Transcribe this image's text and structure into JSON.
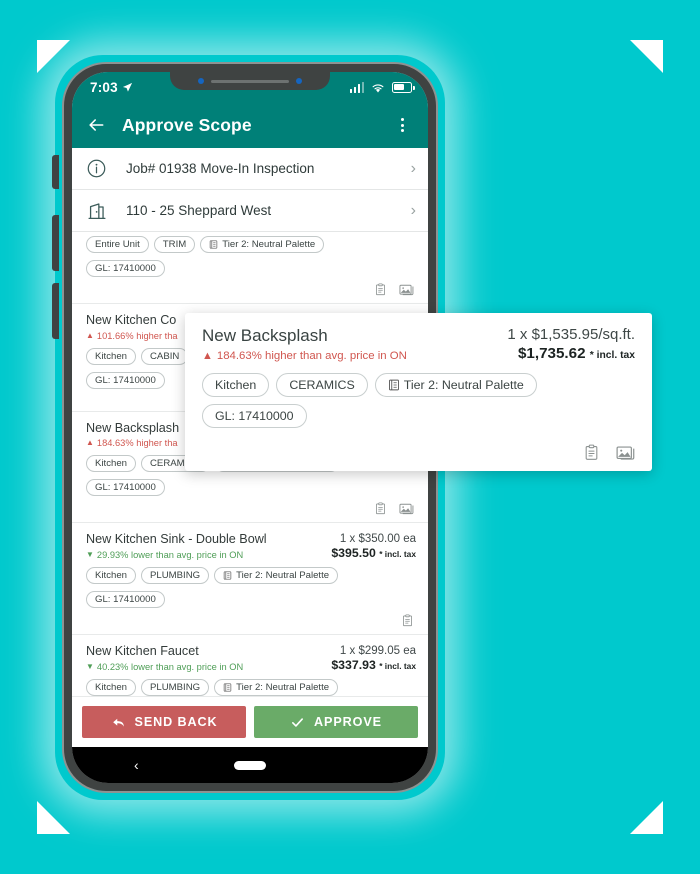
{
  "theme": {
    "background": "#00c9cd",
    "appbar": "#008078",
    "up_color": "#d0564f",
    "down_color": "#4f9e57",
    "send_back_color": "#c75d5d",
    "approve_color": "#6aab68"
  },
  "statusbar": {
    "time": "7:03"
  },
  "appbar": {
    "title": "Approve Scope"
  },
  "header_rows": [
    {
      "icon": "info-circle-icon",
      "text": "Job# 01938 Move-In Inspection"
    },
    {
      "icon": "building-icon",
      "text": "110 - 25 Sheppard West"
    }
  ],
  "items": [
    {
      "name": "",
      "delta": "",
      "delta_dir": "",
      "unit": "",
      "total": "",
      "tax_note": "",
      "chips": [
        "Entire Unit",
        "TRIM",
        "Tier 2: Neutral Palette",
        "GL: 17410000"
      ],
      "palette_chip_index": 2,
      "actions": [
        "clipboard-icon",
        "photo-icon"
      ]
    },
    {
      "name": "New Kitchen Co",
      "delta": "101.66% higher tha",
      "delta_dir": "up",
      "unit": "",
      "total": "",
      "tax_note": "",
      "chips": [
        "Kitchen",
        "CABIN",
        "GL: 17410000"
      ],
      "palette_chip_index": -1,
      "actions": []
    },
    {
      "name": "New Backsplash",
      "delta": "184.63% higher tha",
      "delta_dir": "up",
      "unit": "",
      "total": "",
      "tax_note": "",
      "chips": [
        "Kitchen",
        "CERAMICS",
        "Tier 2: Neutral Palette",
        "GL: 17410000"
      ],
      "palette_chip_index": 2,
      "actions": [
        "clipboard-icon",
        "photo-icon"
      ]
    },
    {
      "name": "New Kitchen Sink - Double Bowl",
      "delta": "29.93% lower than avg. price in ON",
      "delta_dir": "down",
      "unit": "1 x $350.00 ea",
      "total": "$395.50",
      "tax_note": "* incl. tax",
      "chips": [
        "Kitchen",
        "PLUMBING",
        "Tier 2: Neutral Palette",
        "GL: 17410000"
      ],
      "palette_chip_index": 2,
      "actions": [
        "clipboard-icon"
      ]
    },
    {
      "name": "New Kitchen Faucet",
      "delta": "40.23% lower than avg. price in ON",
      "delta_dir": "down",
      "unit": "1 x $299.05 ea",
      "total": "$337.93",
      "tax_note": "* incl. tax",
      "chips": [
        "Kitchen",
        "PLUMBING",
        "Tier 2: Neutral Palette"
      ],
      "palette_chip_index": 2,
      "actions": []
    }
  ],
  "popup": {
    "name": "New Backsplash",
    "delta": "184.63% higher than avg. price in ON",
    "delta_dir": "up",
    "unit": "1 x $1,535.95/sq.ft.",
    "total": "$1,735.62",
    "tax_note": "* incl. tax",
    "chips": [
      "Kitchen",
      "CERAMICS",
      "Tier 2: Neutral Palette",
      "GL: 17410000"
    ],
    "palette_chip_index": 2,
    "actions": [
      "clipboard-icon",
      "photo-icon"
    ]
  },
  "actions": {
    "send_back_label": "SEND BACK",
    "approve_label": "APPROVE"
  }
}
